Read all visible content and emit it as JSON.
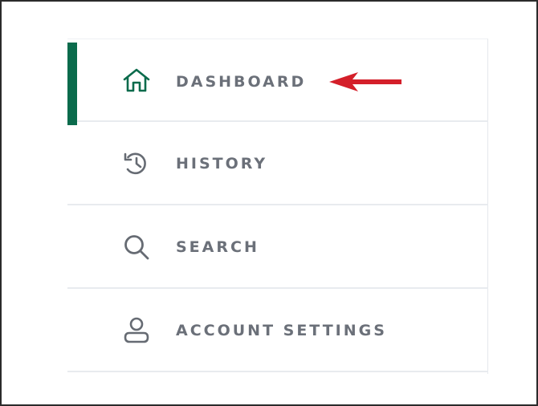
{
  "nav": {
    "items": [
      {
        "label": "DASHBOARD",
        "icon": "home-icon",
        "active": true
      },
      {
        "label": "HISTORY",
        "icon": "history-icon",
        "active": false
      },
      {
        "label": "SEARCH",
        "icon": "search-icon",
        "active": false
      },
      {
        "label": "ACCOUNT SETTINGS",
        "icon": "user-icon",
        "active": false
      }
    ]
  },
  "annotation": {
    "icon": "arrow-left-icon"
  },
  "colors": {
    "accent": "#0b6b4c",
    "annotation": "#d41f2a",
    "label": "#6b7079",
    "icon": "#666b73",
    "divider": "#e8ebef"
  }
}
